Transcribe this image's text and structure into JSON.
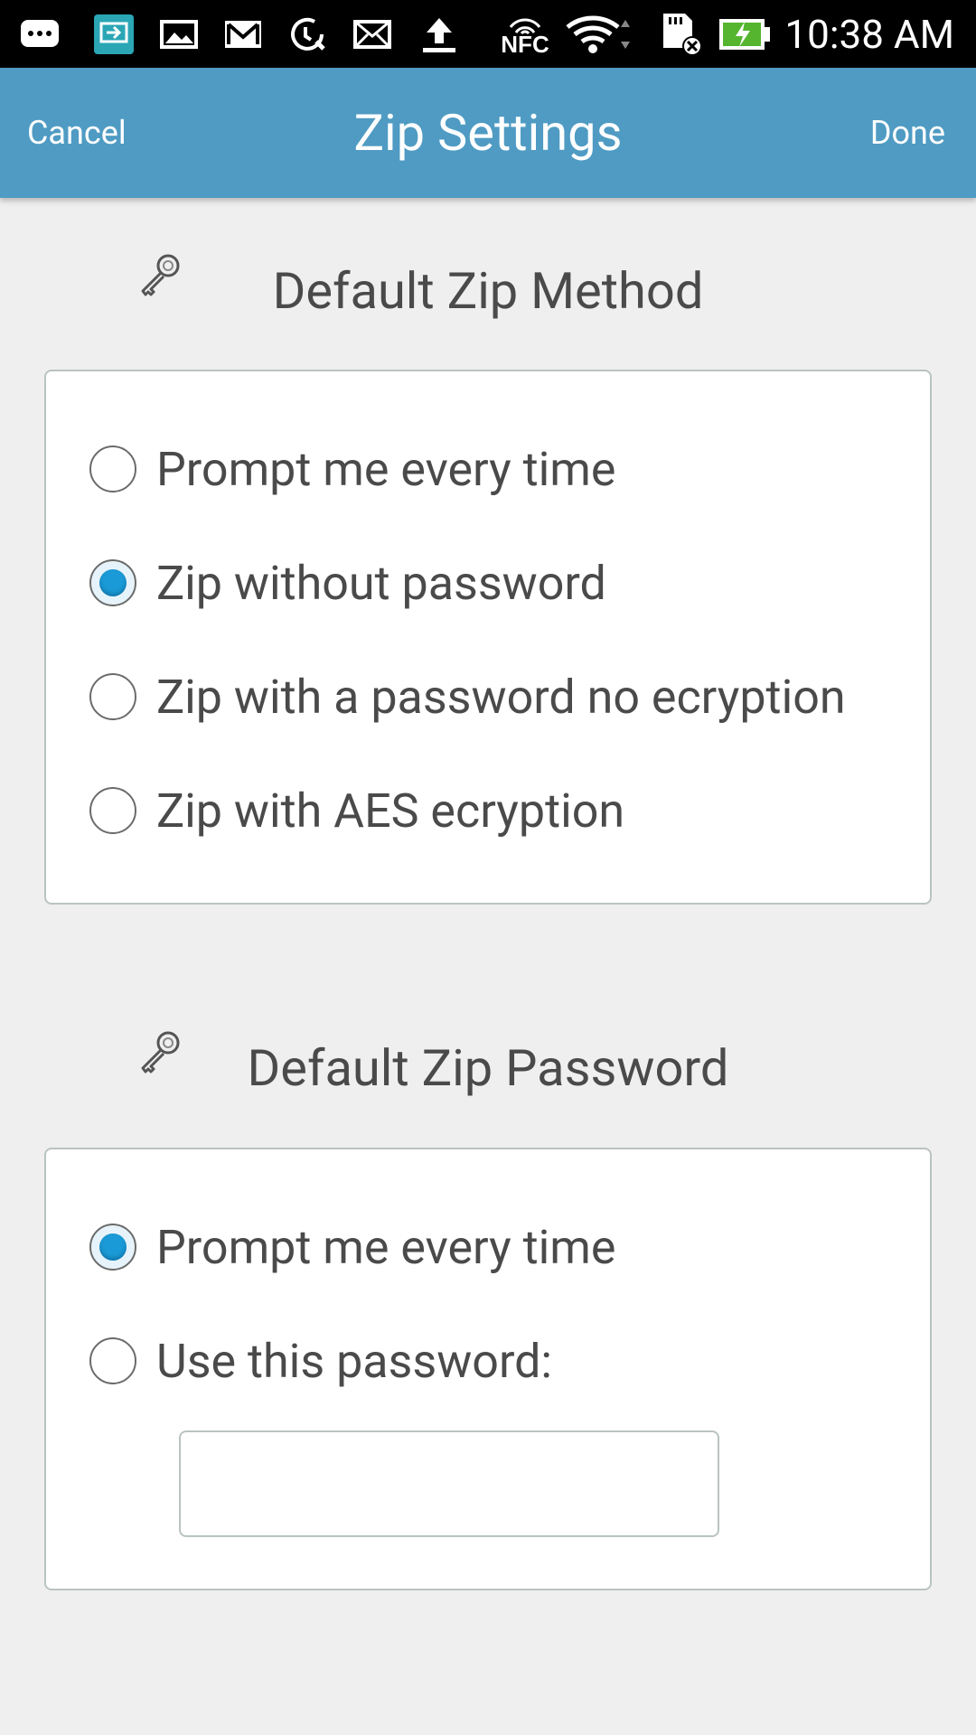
{
  "status_bar": {
    "time": "10:38 AM",
    "icons": [
      "message-icon",
      "screen-mirror-icon",
      "image-icon",
      "gmail-icon",
      "settings-sync-icon",
      "mail-icon",
      "upload-icon",
      "nfc-icon",
      "wifi-icon",
      "sd-card-icon",
      "battery-charging-icon"
    ],
    "nfc_label": "NFC"
  },
  "app_bar": {
    "cancel_label": "Cancel",
    "title": "Zip Settings",
    "done_label": "Done"
  },
  "zip_method": {
    "heading": "Default Zip Method",
    "icon": "key-icon",
    "options": [
      {
        "label": "Prompt me every time",
        "checked": false
      },
      {
        "label": "Zip without password",
        "checked": true
      },
      {
        "label": "Zip with a password no ecryption",
        "checked": false
      },
      {
        "label": "Zip with AES ecryption",
        "checked": false
      }
    ]
  },
  "zip_password": {
    "heading": "Default Zip Password",
    "icon": "key-icon",
    "options": [
      {
        "label": "Prompt me every time",
        "checked": true
      },
      {
        "label": "Use this password:",
        "checked": false
      }
    ],
    "password_value": "",
    "password_placeholder": ""
  },
  "colors": {
    "app_bar": "#4f9bc3",
    "radio_selected": "#1a9ad6",
    "background": "#efefef"
  }
}
